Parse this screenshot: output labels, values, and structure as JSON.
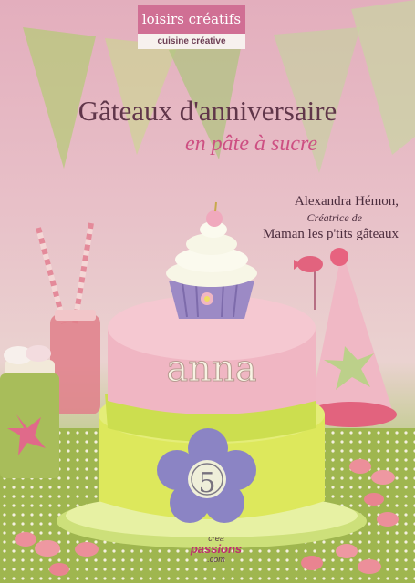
{
  "series": {
    "name": "loisirs créatifs",
    "collection": "cuisine créative"
  },
  "book": {
    "title": "Gâteaux d'anniversaire",
    "subtitle": "en pâte à sucre"
  },
  "author": {
    "name": "Alexandra Hémon,",
    "role": "Créatrice de",
    "brand": "Maman les p'tits gâteaux"
  },
  "cake": {
    "name": "anna",
    "number": "5"
  },
  "publisher": {
    "line1": "crea",
    "line2": "passions",
    "line3": ".com"
  },
  "colors": {
    "series_band": "#d06f94",
    "title": "#60364a",
    "subtitle": "#cd4f82"
  }
}
